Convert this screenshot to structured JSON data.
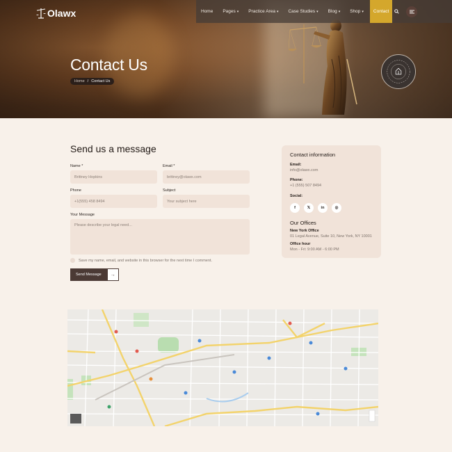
{
  "brand": {
    "name": "Olawx"
  },
  "nav": {
    "items": [
      {
        "label": "Home",
        "caret": false
      },
      {
        "label": "Pages",
        "caret": true
      },
      {
        "label": "Practice Area",
        "caret": true
      },
      {
        "label": "Case Studies",
        "caret": true
      },
      {
        "label": "Blog",
        "caret": true
      },
      {
        "label": "Shop",
        "caret": true
      },
      {
        "label": "Contact",
        "caret": false,
        "active": true
      }
    ],
    "search_icon": "search-icon",
    "menu_icon": "menu-icon"
  },
  "hero": {
    "title": "Contact Us",
    "breadcrumb": {
      "home": "Home",
      "separator": "/",
      "current": "Contact Us"
    },
    "badge_text": "Need Any Help • Contact Us • +1(555)"
  },
  "form": {
    "title": "Send us a message",
    "name_label": "Name *",
    "name_placeholder": "Brittney Hopkins",
    "email_label": "Email *",
    "email_placeholder": "brittney@olawx.com",
    "phone_label": "Phone",
    "phone_placeholder": "+1(555) 458 8494",
    "subject_label": "Subject",
    "subject_placeholder": "Your subject here",
    "message_label": "Your Message",
    "message_placeholder": "Please describe your legal need...",
    "save_label": "Save my name, email, and website in this browser for the next time I comment.",
    "send_label": "Send Message",
    "send_icon": "arrow-right-icon"
  },
  "contact": {
    "title": "Contact information",
    "email_label": "Email:",
    "email": "info@olawx.com",
    "phone_label": "Phone:",
    "phone": "+1 (555) 507 8494",
    "social_label": "Social:",
    "socials": [
      {
        "icon": "facebook-icon",
        "glyph": "f"
      },
      {
        "icon": "x-icon",
        "glyph": "𝕏"
      },
      {
        "icon": "linkedin-icon",
        "glyph": "in"
      },
      {
        "icon": "instagram-icon",
        "glyph": "◎"
      }
    ],
    "offices_title": "Our Offices",
    "office_name": "New York Office",
    "office_address": "01 Legal Avenue, Suite 10, New York, NY 10001",
    "hours_label": "Office hour",
    "hours": "Mon - Fri: 9:00 AM - 6:00 PM"
  },
  "colors": {
    "accent": "#d4a72c",
    "dark": "#4b3a35",
    "bg": "#f8f1ea",
    "field": "#f1e3d9"
  }
}
